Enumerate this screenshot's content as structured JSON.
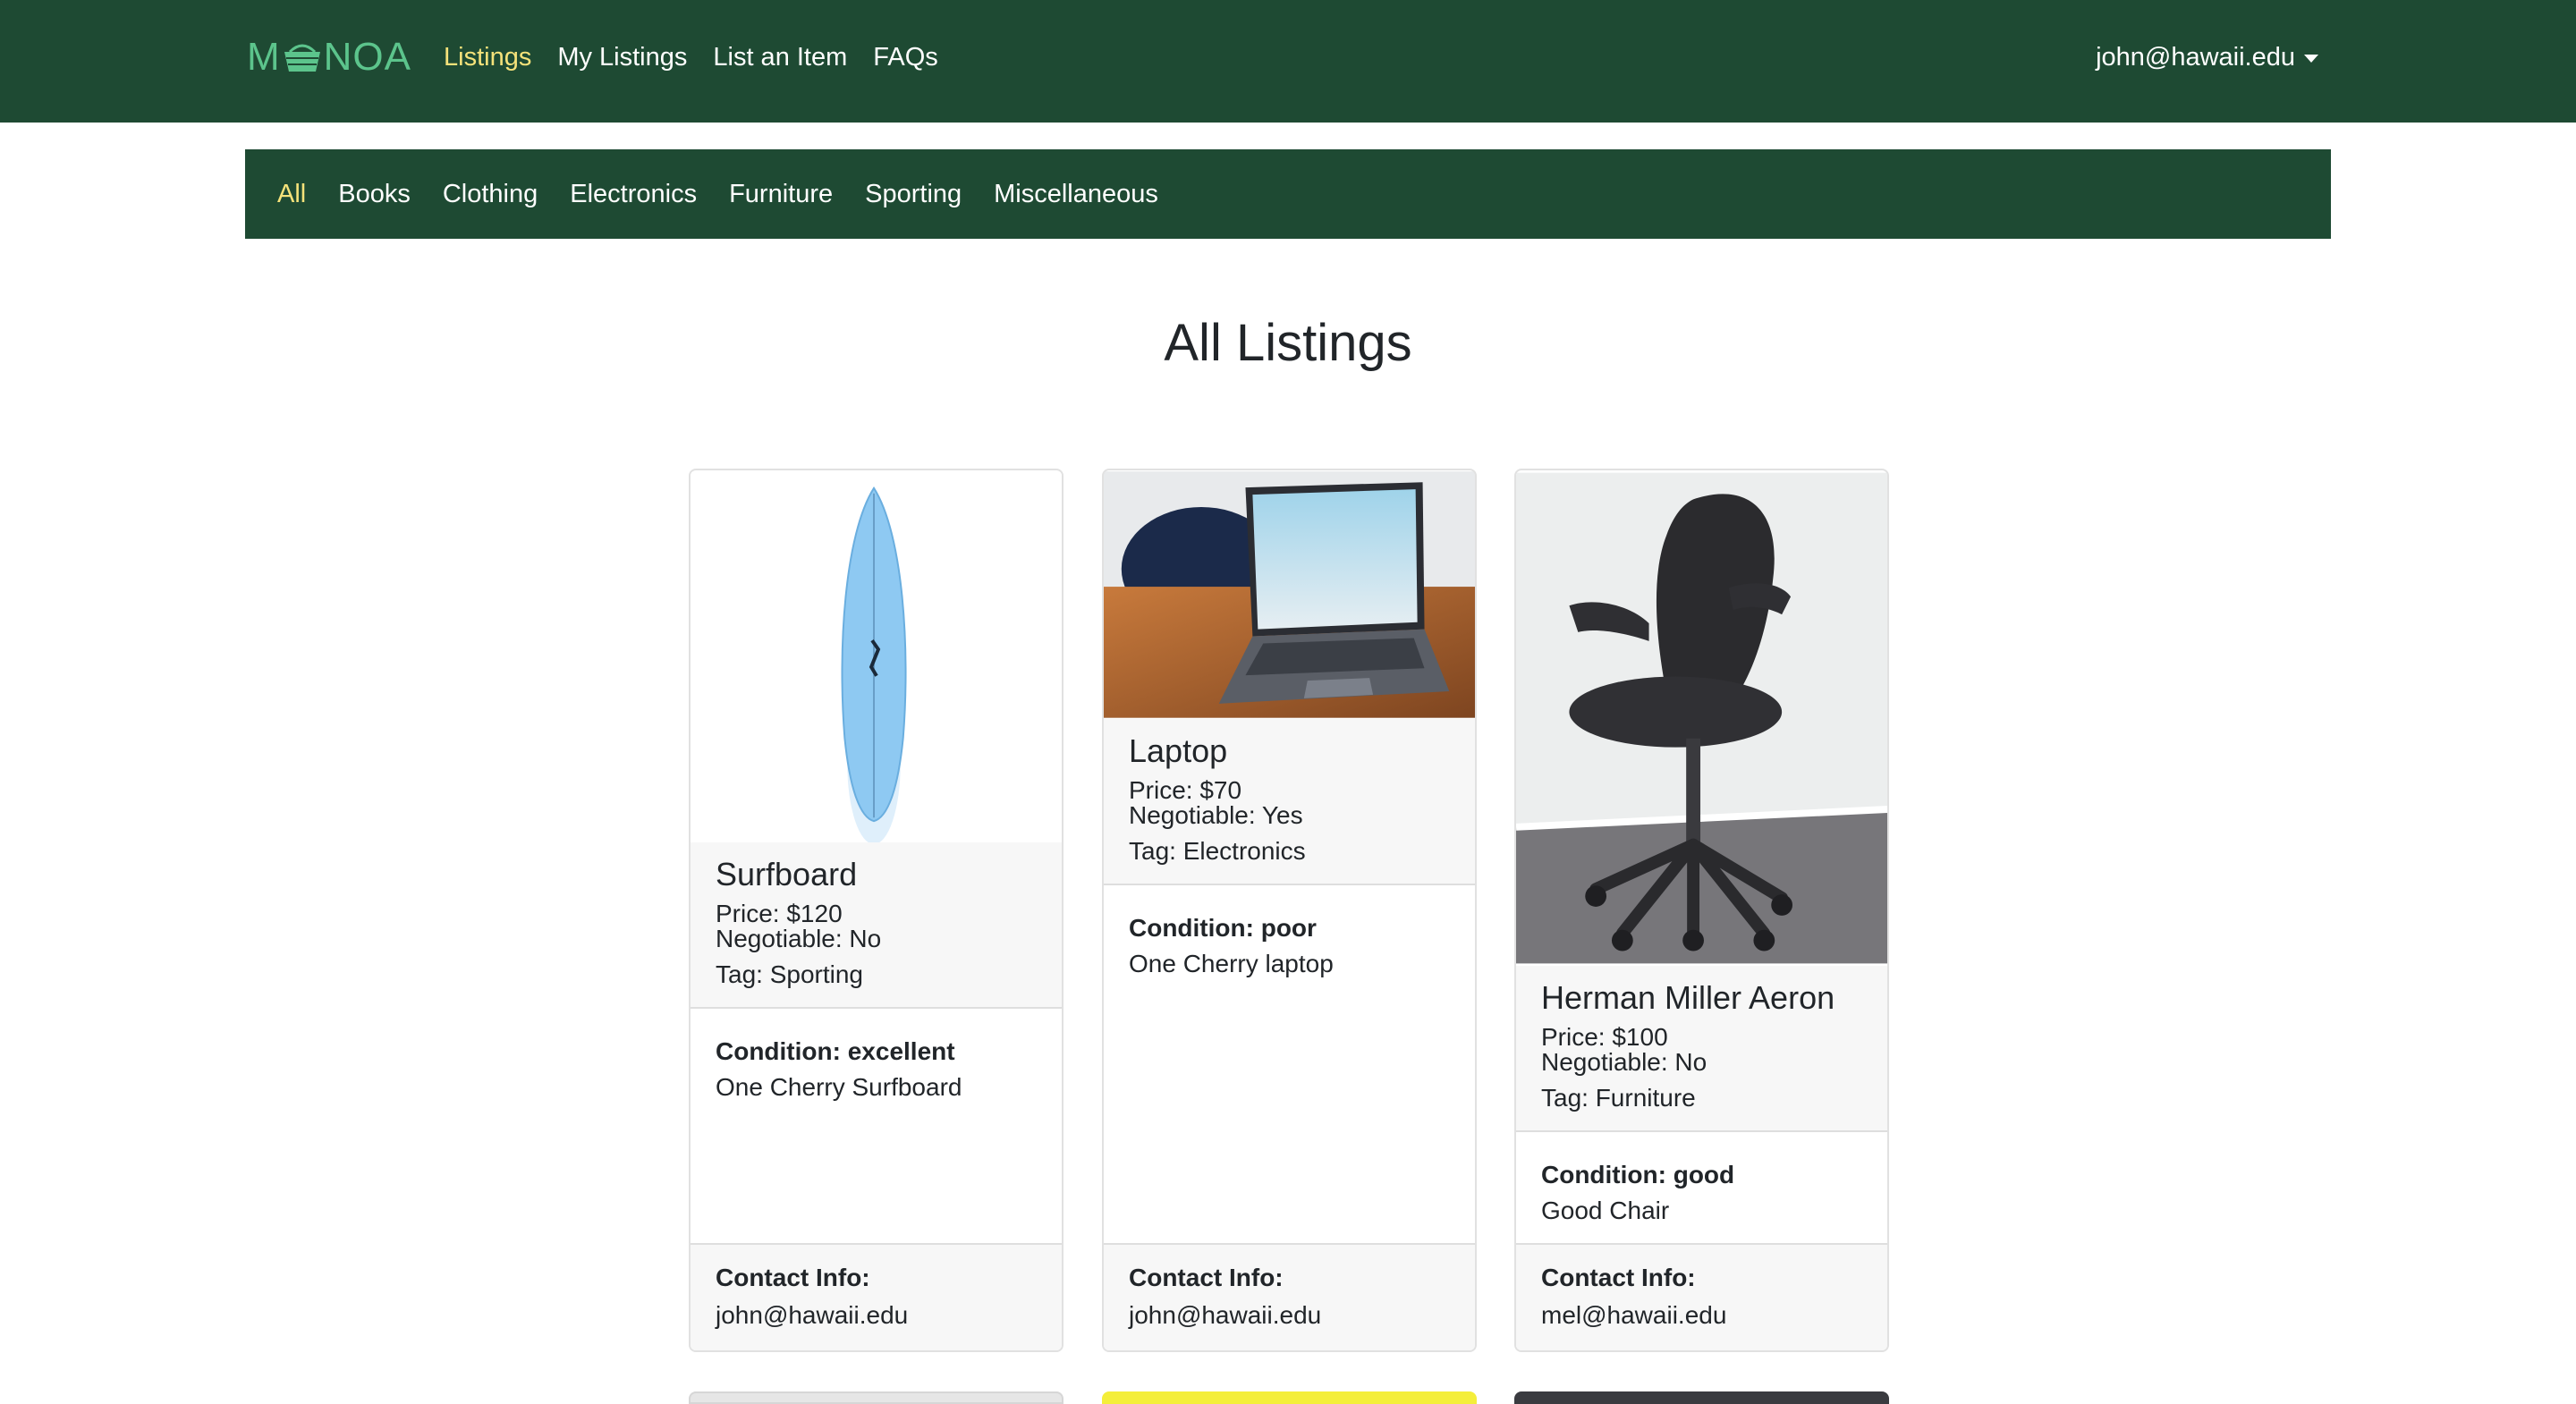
{
  "navbar": {
    "brand_left": "M",
    "brand_right": "NOA",
    "links": [
      "Listings",
      "My Listings",
      "List an Item",
      "FAQs"
    ],
    "user": "john@hawaii.edu"
  },
  "categories": [
    "All",
    "Books",
    "Clothing",
    "Electronics",
    "Furniture",
    "Sporting",
    "Miscellaneous"
  ],
  "page_title": "All Listings",
  "contact_label": "Contact Info:",
  "listings": [
    {
      "name": "Surfboard",
      "price": "Price: $120",
      "negotiable": "Negotiable: No",
      "tag": "Tag: Sporting",
      "condition": "Condition: excellent",
      "description": "One Cherry Surfboard",
      "contact": "john@hawaii.edu"
    },
    {
      "name": "Laptop",
      "price": "Price: $70",
      "negotiable": "Negotiable: Yes",
      "tag": "Tag: Electronics",
      "condition": "Condition: poor",
      "description": "One Cherry laptop",
      "contact": "john@hawaii.edu"
    },
    {
      "name": "Herman Miller Aeron",
      "price": "Price: $100",
      "negotiable": "Negotiable: No",
      "tag": "Tag: Furniture",
      "condition": "Condition: good",
      "description": "Good Chair",
      "contact": "mel@hawaii.edu"
    }
  ]
}
